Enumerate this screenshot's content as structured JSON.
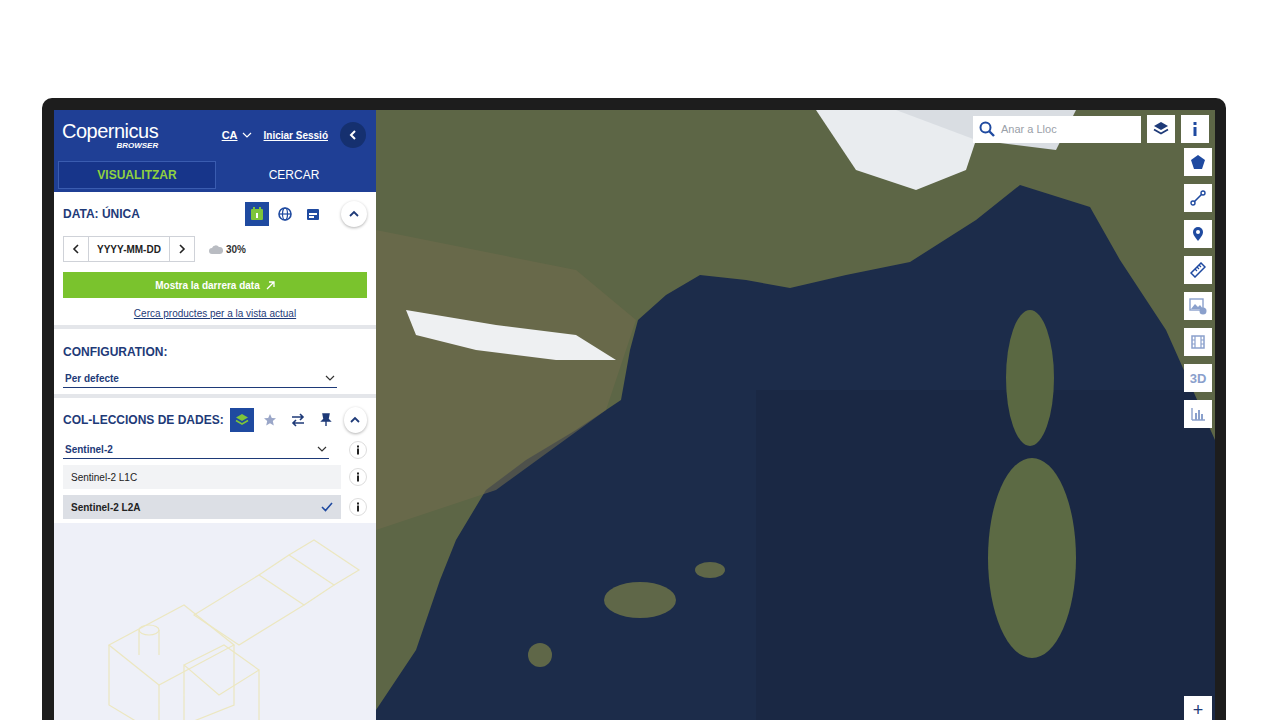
{
  "header": {
    "logo_title": "Copernicus",
    "logo_subtitle": "BROWSER",
    "language": "CA",
    "login": "Iniciar Sessió"
  },
  "tabs": [
    {
      "label": "VISUALITZAR",
      "selected": true
    },
    {
      "label": "CERCAR",
      "selected": false
    }
  ],
  "date_section": {
    "title": "DATA: ÚNICA",
    "expanded": true,
    "modes": [
      {
        "kind": "single",
        "selected": true
      },
      {
        "kind": "mosaic",
        "selected": false
      },
      {
        "kind": "range",
        "selected": false
      }
    ],
    "date_placeholder": "YYYY-MM-DD",
    "cloud_coverage": "30%",
    "latest_button": "Mostra la darrera data",
    "search_link": "Cerca productes per a la vista actual"
  },
  "configuration": {
    "title": "CONFIGURATION:",
    "value": "Per defecte"
  },
  "collections": {
    "title": "COL-LECCIONS DE DADES:",
    "expanded": true,
    "tools": [
      {
        "kind": "layers",
        "selected": true
      },
      {
        "kind": "star",
        "selected": false
      },
      {
        "kind": "compare",
        "selected": false
      },
      {
        "kind": "pin",
        "selected": false
      }
    ],
    "group": "Sentinel-2",
    "items": [
      {
        "label": "Sentinel-2 L1C",
        "selected": false
      },
      {
        "label": "Sentinel-2 L2A",
        "selected": true
      }
    ]
  },
  "map": {
    "search_placeholder": "Anar a Lloc",
    "tools": [
      {
        "kind": "polygon",
        "label": ""
      },
      {
        "kind": "line",
        "label": ""
      },
      {
        "kind": "poi",
        "label": ""
      },
      {
        "kind": "measure",
        "label": ""
      },
      {
        "kind": "image",
        "label": ""
      },
      {
        "kind": "video",
        "label": ""
      },
      {
        "kind": "3d",
        "label": "3D"
      },
      {
        "kind": "histogram",
        "label": ""
      }
    ],
    "zoom_in": "+"
  }
}
